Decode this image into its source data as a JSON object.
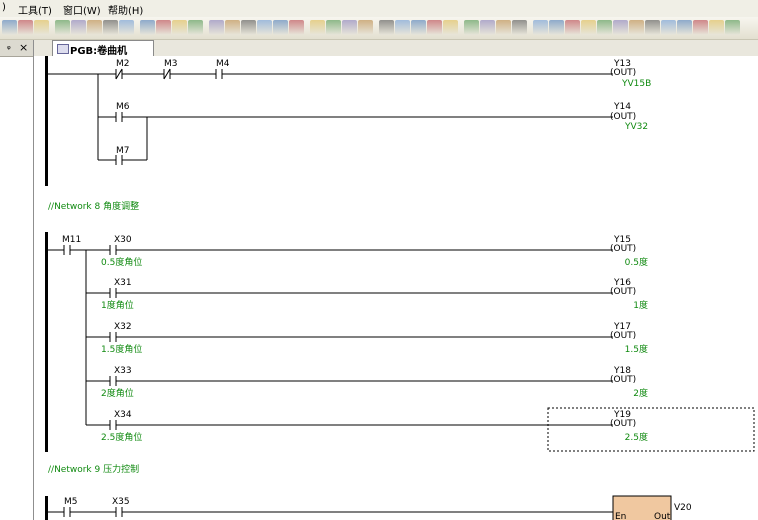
{
  "menu": [
    "工具(T)",
    "窗口(W)",
    "帮助(H)"
  ],
  "panel_controls": {
    "pin": "ᵩ",
    "close": "×"
  },
  "tab": {
    "label": "PGB:卷曲机"
  },
  "net7": {
    "row1": [
      "M2",
      "M3",
      "M4"
    ],
    "row1_coil": {
      "addr": "Y13",
      "sym": "YV15B"
    },
    "row2": "M6",
    "row2_coil": {
      "addr": "Y14",
      "sym": "YV32"
    },
    "row3": "M7"
  },
  "net8": {
    "title": "//Network 8  角度调整",
    "enable": "M11",
    "rows": [
      {
        "contact": "X30",
        "desc": "0.5度角位",
        "coil": "Y15",
        "coil_sym": "0.5度"
      },
      {
        "contact": "X31",
        "desc": "1度角位",
        "coil": "Y16",
        "coil_sym": "1度"
      },
      {
        "contact": "X32",
        "desc": "1.5度角位",
        "coil": "Y17",
        "coil_sym": "1.5度"
      },
      {
        "contact": "X33",
        "desc": "2度角位",
        "coil": "Y18",
        "coil_sym": "2度"
      },
      {
        "contact": "X34",
        "desc": "2.5度角位",
        "coil": "Y19",
        "coil_sym": "2.5度"
      }
    ]
  },
  "net9": {
    "title": "//Network 9  压力控制",
    "contacts": [
      "M5",
      "X35"
    ],
    "block": {
      "in": "En",
      "out": "Out",
      "addr": "V20"
    }
  },
  "coil_text": "(OUT)",
  "colors": {
    "green": "#108a10",
    "rail": "#000000",
    "block": "#f0c8a0"
  }
}
